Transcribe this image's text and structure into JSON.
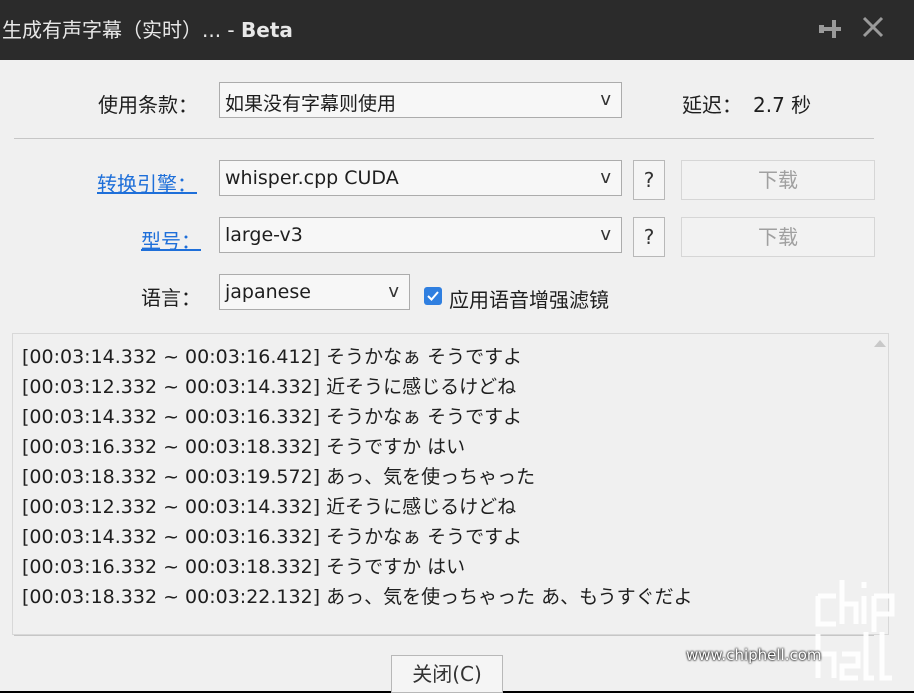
{
  "window": {
    "title_main": "生成有声字幕（实时）... - ",
    "title_beta": "Beta",
    "pin_icon": "pin-icon",
    "close_icon": "close-icon"
  },
  "form": {
    "terms_label": "使用条款：",
    "terms_value": "如果没有字幕则使用",
    "delay_label": "延迟：",
    "delay_value": "2.7 秒",
    "engine_label": "转换引擎：",
    "engine_value": "whisper.cpp CUDA",
    "model_label": "型号：",
    "model_value": "large-v3",
    "language_label": "语言：",
    "language_value": "japanese",
    "help_label": "?",
    "download_label": "下载",
    "voice_enhance_label": "应用语音增强滤镜",
    "voice_enhance_checked": true,
    "dropdown_arrow": "v"
  },
  "log_lines": [
    "[00:03:14.332 ~ 00:03:16.412] そうかなぁ そうですよ",
    "[00:03:12.332 ~ 00:03:14.332] 近そうに感じるけどね",
    "[00:03:14.332 ~ 00:03:16.332] そうかなぁ そうですよ",
    "[00:03:16.332 ~ 00:03:18.332] そうですか はい",
    "[00:03:18.332 ~ 00:03:19.572] あっ、気を使っちゃった",
    "[00:03:12.332 ~ 00:03:14.332] 近そうに感じるけどね",
    "[00:03:14.332 ~ 00:03:16.332] そうかなぁ そうですよ",
    "[00:03:16.332 ~ 00:03:18.332] そうですか はい",
    "[00:03:18.332 ~ 00:03:22.132] あっ、気を使っちゃった あ、もうすぐだよ"
  ],
  "footer": {
    "close_label": "关闭(C)"
  },
  "watermark": {
    "url": "www.chiphell.com",
    "logo_text": "chip hell"
  },
  "colors": {
    "titlebar": "#2b2b2b",
    "client": "#f0f0f0",
    "link": "#1e6fd9",
    "checkbox": "#2f7fe0"
  }
}
